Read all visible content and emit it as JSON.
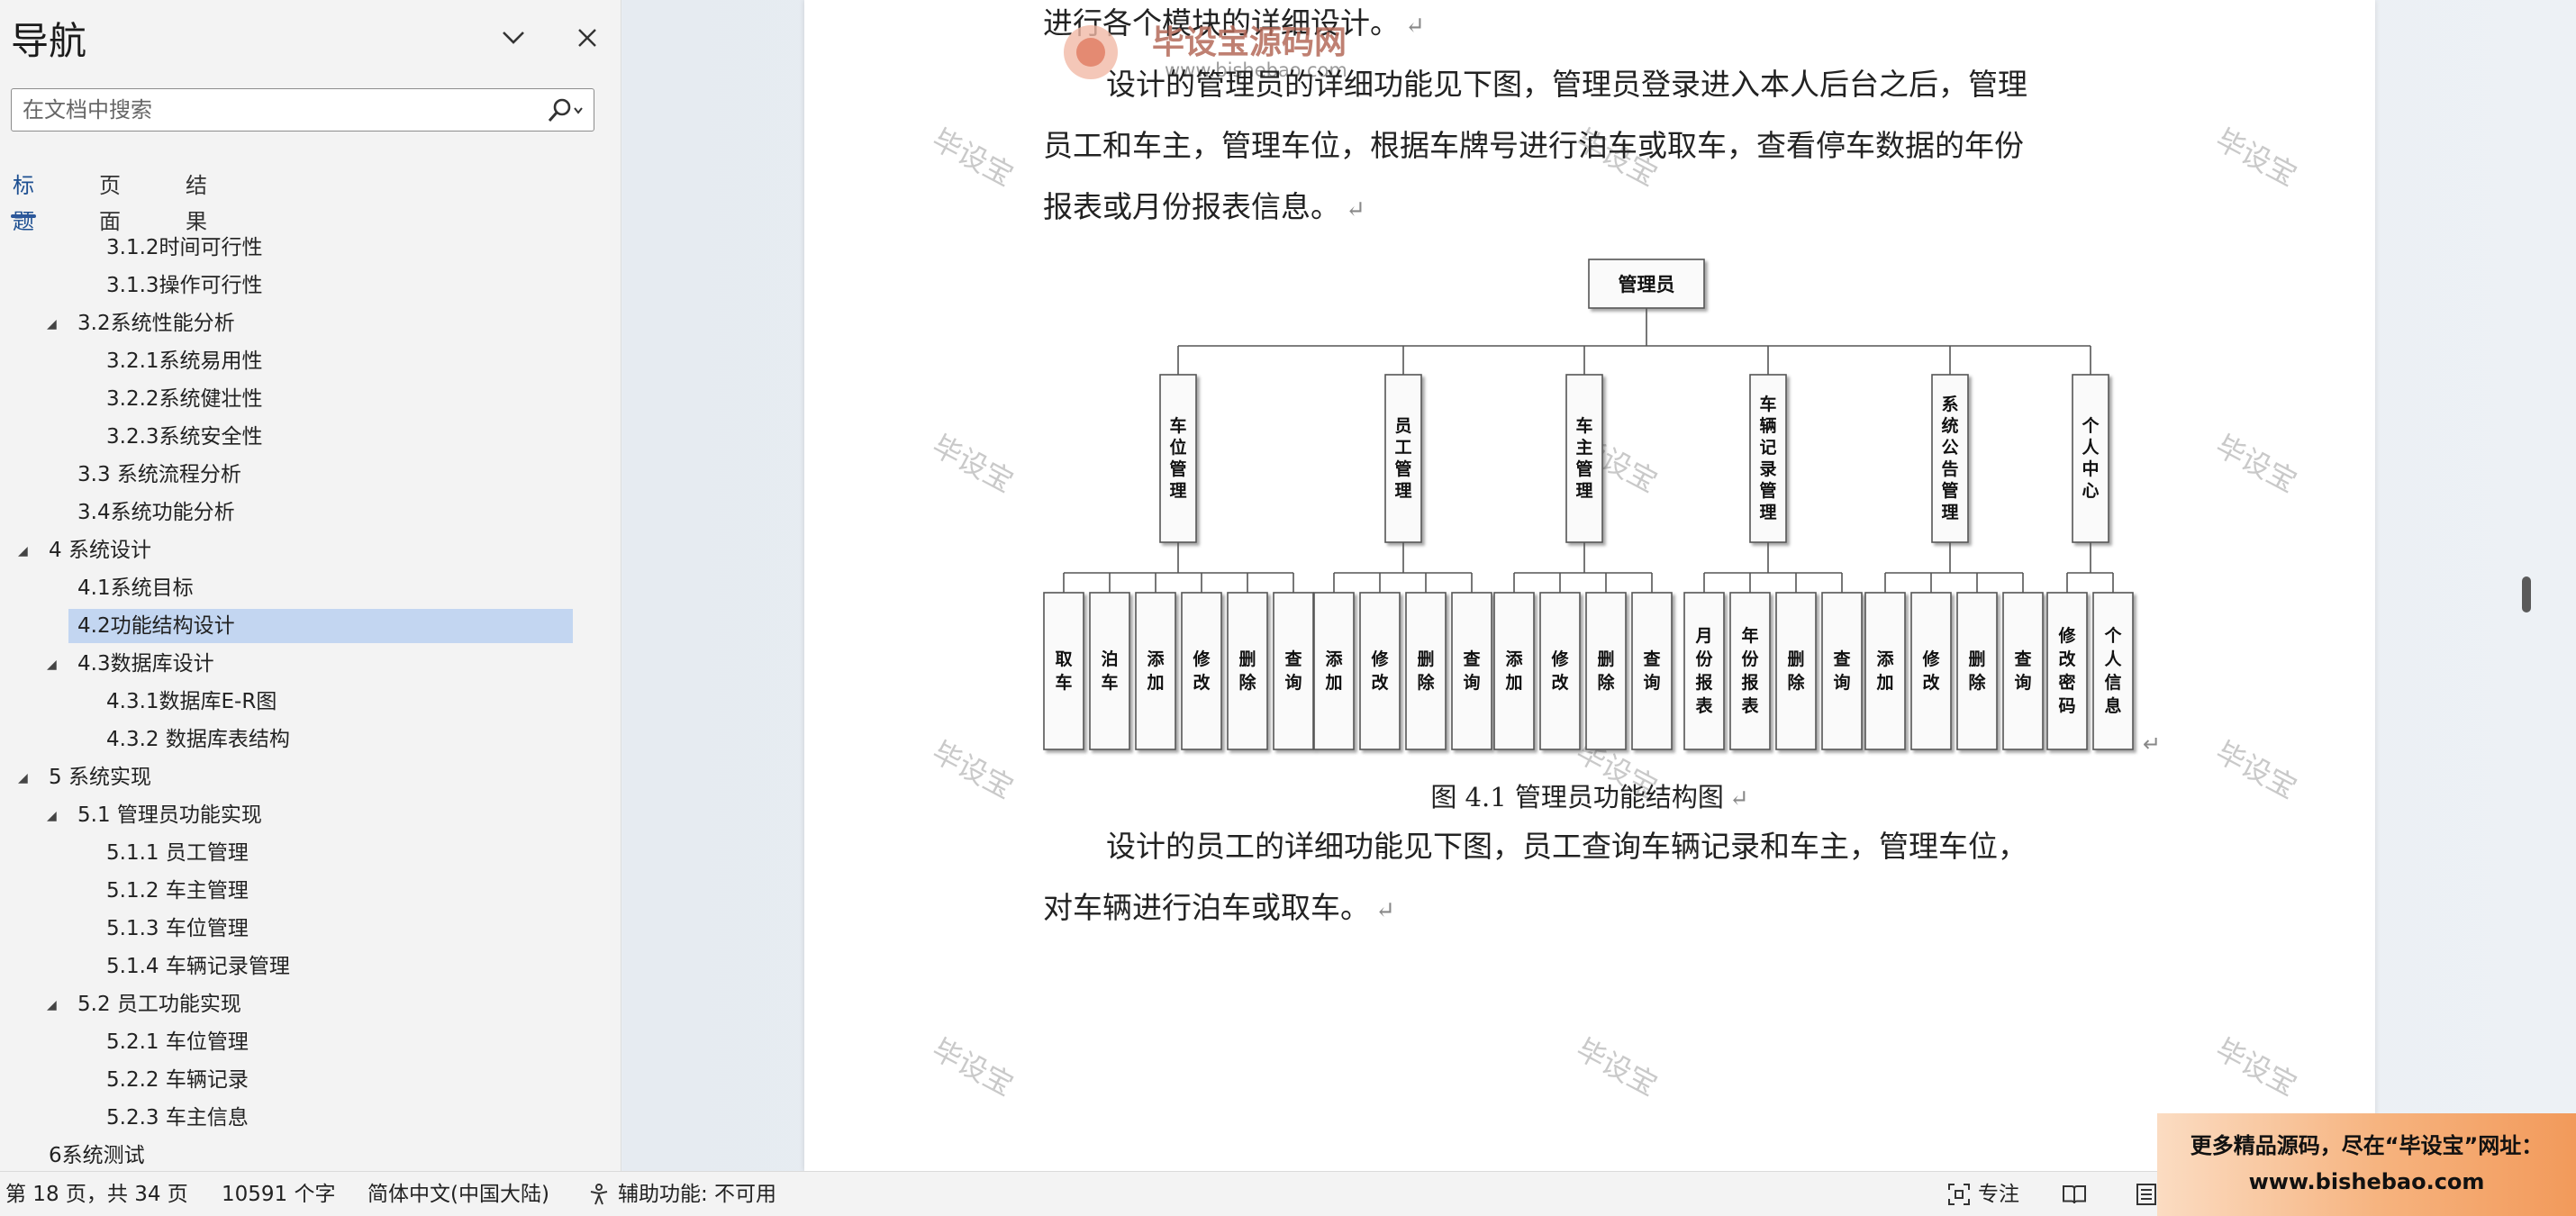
{
  "nav": {
    "title": "导航",
    "search_placeholder": "在文档中搜索",
    "tabs": [
      "标题",
      "页面",
      "结果"
    ],
    "items": [
      "3.1.2时间可行性",
      "3.1.3操作可行性",
      "3.2系统性能分析",
      "3.2.1系统易用性",
      "3.2.2系统健壮性",
      "3.2.3系统安全性",
      "3.3 系统流程分析",
      "3.4系统功能分析",
      "4 系统设计",
      "4.1系统目标",
      "4.2功能结构设计",
      "4.3数据库设计",
      "4.3.1数据库E-R图",
      "4.3.2 数据库表结构",
      "5 系统实现",
      "5.1 管理员功能实现",
      "5.1.1 员工管理",
      "5.1.2 车主管理",
      "5.1.3 车位管理",
      "5.1.4 车辆记录管理",
      "5.2 员工功能实现",
      "5.2.1 车位管理",
      "5.2.2 车辆记录",
      "5.2.3 车主信息",
      "6系统测试"
    ]
  },
  "document": {
    "line_top": "进行各个模块的详细设计。",
    "para1": "设计的管理员的详细功能见下图，管理员登录进入本人后台之后，管理员工和车主，管理车位，根据车牌号进行泊车或取车，查看停车数据的年份报表或月份报表信息。",
    "caption": "图 4.1  管理员功能结构图",
    "para2": "设计的员工的详细功能见下图，员工查询车辆记录和车主，管理车位，对车辆进行泊车或取车。"
  },
  "diagram": {
    "root": "管理员",
    "modules": [
      {
        "name": "车位管理",
        "leaves": [
          "取车",
          "泊车",
          "添加",
          "修改",
          "删除",
          "查询"
        ]
      },
      {
        "name": "员工管理",
        "leaves": [
          "添加",
          "修改",
          "删除",
          "查询"
        ]
      },
      {
        "name": "车主管理",
        "leaves": [
          "添加",
          "修改",
          "删除",
          "查询"
        ]
      },
      {
        "name": "车辆记录管理",
        "leaves": [
          "月份报表",
          "年份报表",
          "删除",
          "查询"
        ]
      },
      {
        "name": "系统公告管理",
        "leaves": [
          "添加",
          "修改",
          "删除",
          "查询"
        ]
      },
      {
        "name": "个人中心",
        "leaves": [
          "修改密码",
          "个人信息"
        ]
      }
    ]
  },
  "watermark": {
    "text": "毕设宝",
    "brand": "毕设宝源码网",
    "url": "www.bishebao.com"
  },
  "status": {
    "page": "第 18 页，共 34 页",
    "words": "10591 个字",
    "language": "简体中文(中国大陆)",
    "accessibility": "辅助功能: 不可用",
    "focus": "专注"
  },
  "promo": {
    "line1": "更多精品源码，尽在“毕设宝”网址：",
    "line2": "www.bishebao.com"
  }
}
